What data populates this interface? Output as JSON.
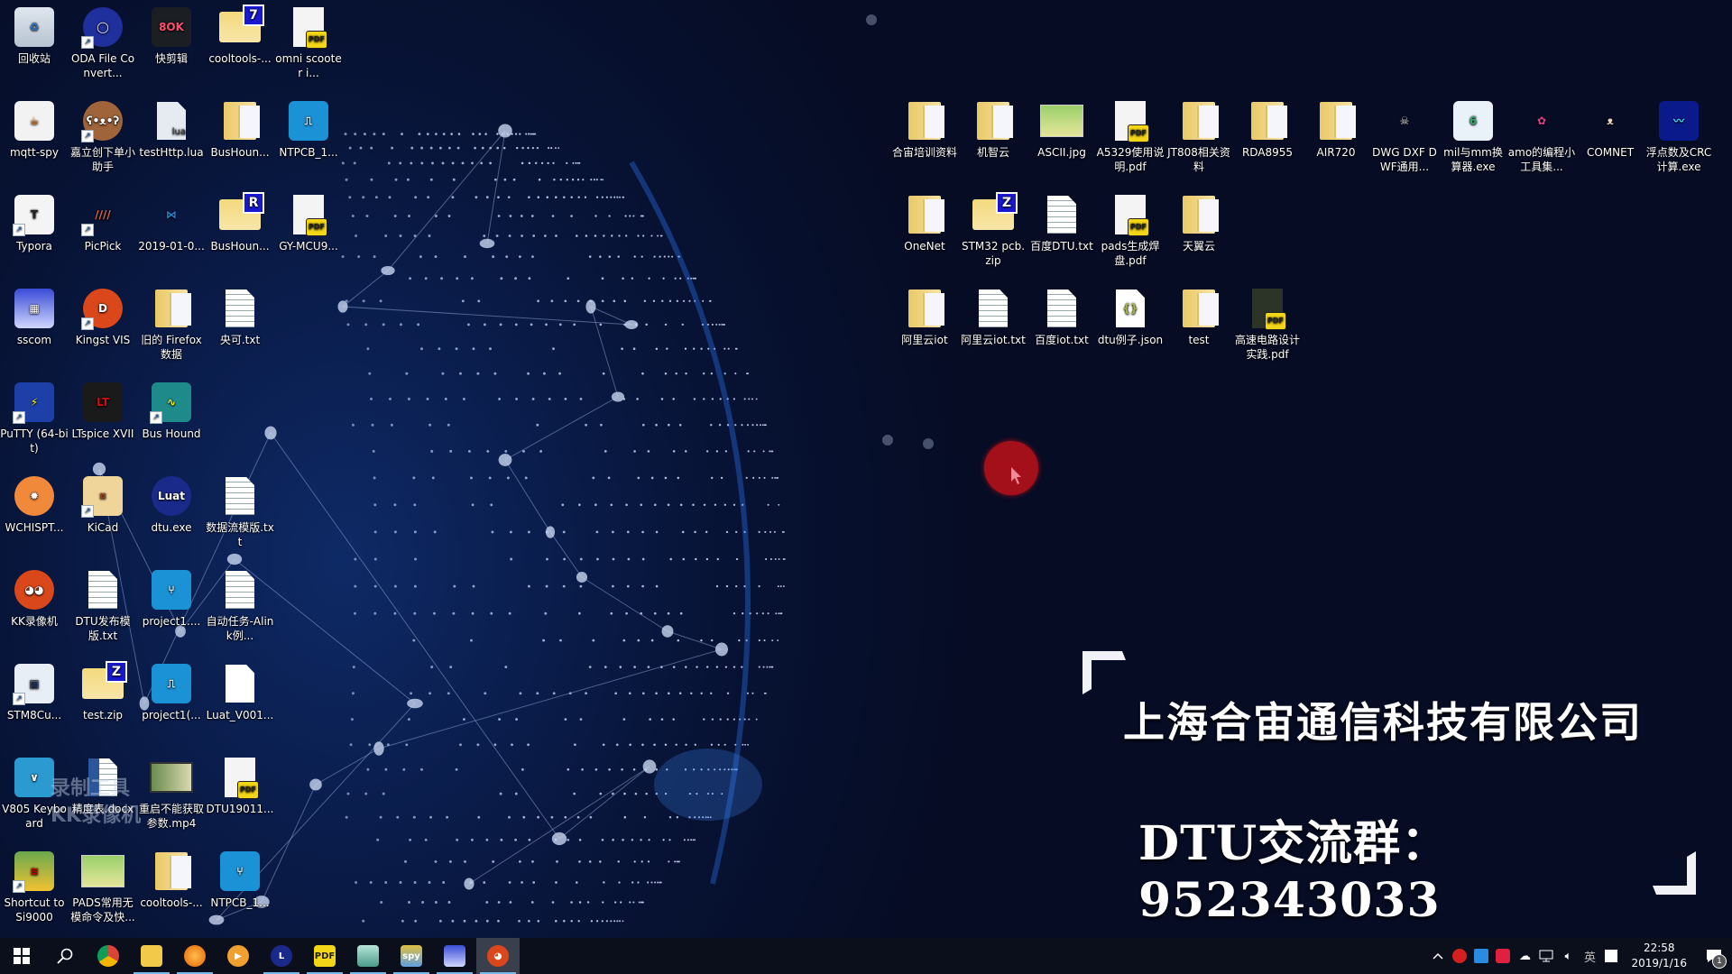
{
  "desktop": {
    "left_icons": [
      {
        "label": "回收站",
        "icon": "recycle-bin-icon",
        "shortcut": false
      },
      {
        "label": "ODA File Convert...",
        "icon": "oda-converter-icon",
        "shortcut": true
      },
      {
        "label": "快剪辑",
        "icon": "kuaijianji-icon",
        "shortcut": false
      },
      {
        "label": "cooltools-...",
        "icon": "zip-folder-icon",
        "shortcut": false,
        "badge": "7"
      },
      {
        "label": "omni scooter i...",
        "icon": "pdf-file-icon",
        "shortcut": false
      },
      {
        "label": "mqtt-spy",
        "icon": "java-icon",
        "shortcut": false
      },
      {
        "label": "嘉立创下单小助手",
        "icon": "bear-app-icon",
        "shortcut": true
      },
      {
        "label": "testHttp.lua",
        "icon": "lua-file-icon",
        "shortcut": false
      },
      {
        "label": "BusHoun...",
        "icon": "folder-icon",
        "shortcut": false
      },
      {
        "label": "NTPCB_1...",
        "icon": "ntpcb-project-icon",
        "shortcut": false
      },
      {
        "label": "Typora",
        "icon": "typora-icon",
        "shortcut": true
      },
      {
        "label": "PicPick",
        "icon": "picpick-icon",
        "shortcut": true
      },
      {
        "label": "2019-01-0...",
        "icon": "vscode-icon",
        "shortcut": false
      },
      {
        "label": "BusHoun...",
        "icon": "zip-folder-icon",
        "shortcut": false,
        "badge": "R"
      },
      {
        "label": "GY-MCU9...",
        "icon": "pdf-file-icon",
        "shortcut": false
      },
      {
        "label": "sscom",
        "icon": "sscom-icon",
        "shortcut": false
      },
      {
        "label": "Kingst VIS",
        "icon": "kingst-icon",
        "shortcut": true
      },
      {
        "label": "旧的 Firefox 数据",
        "icon": "folder-icon",
        "shortcut": false
      },
      {
        "label": "央可.txt",
        "icon": "text-file-icon",
        "shortcut": false
      },
      {
        "label": "PuTTY (64-bit)",
        "icon": "putty-icon",
        "shortcut": true
      },
      {
        "label": "LTspice XVII",
        "icon": "ltspice-icon",
        "shortcut": false
      },
      {
        "label": "Bus Hound",
        "icon": "bushound-icon",
        "shortcut": true
      },
      {
        "label": "WCHISPT...",
        "icon": "wchisp-icon",
        "shortcut": false
      },
      {
        "label": "KiCad",
        "icon": "kicad-icon",
        "shortcut": true
      },
      {
        "label": "dtu.exe",
        "icon": "luat-icon",
        "shortcut": false
      },
      {
        "label": "数据流模版.txt",
        "icon": "text-file-icon",
        "shortcut": false
      },
      {
        "label": "KK录像机",
        "icon": "kk-recorder-icon",
        "shortcut": false
      },
      {
        "label": "DTU发布模版.txt",
        "icon": "text-file-icon",
        "shortcut": false
      },
      {
        "label": "project1....",
        "icon": "ntpcb-icon",
        "shortcut": false
      },
      {
        "label": "自动任务-Alink例...",
        "icon": "text-file-icon",
        "shortcut": false
      },
      {
        "label": "STM8Cu...",
        "icon": "stm8cube-icon",
        "shortcut": true
      },
      {
        "label": "test.zip",
        "icon": "zip-folder-icon",
        "shortcut": false,
        "badge": "Z"
      },
      {
        "label": "project1(...",
        "icon": "ntpcb-project-icon",
        "shortcut": false
      },
      {
        "label": "Luat_V001...",
        "icon": "blank-file-icon",
        "shortcut": false
      },
      {
        "label": "V805 Keyboard",
        "icon": "v805-keyboard-icon",
        "shortcut": false
      },
      {
        "label": "精度表.docx",
        "icon": "word-doc-icon",
        "shortcut": false
      },
      {
        "label": "重启不能获取参数.mp4",
        "icon": "video-file-icon",
        "shortcut": false
      },
      {
        "label": "DTU19011...",
        "icon": "pdf-file-icon",
        "shortcut": false
      },
      {
        "label": "Shortcut to Si9000",
        "icon": "si9000-icon",
        "shortcut": true
      },
      {
        "label": "PADS常用无模命令及快...",
        "icon": "image-file-icon",
        "shortcut": false
      },
      {
        "label": "cooltools-...",
        "icon": "folder-icon",
        "shortcut": false
      },
      {
        "label": "NTPCB_1...",
        "icon": "ntpcb-icon",
        "shortcut": false
      }
    ],
    "right_icons": [
      {
        "label": "合宙培训资料",
        "icon": "folder-icon"
      },
      {
        "label": "机智云",
        "icon": "folder-icon"
      },
      {
        "label": "ASCII.jpg",
        "icon": "image-file-icon"
      },
      {
        "label": "A5329使用说明.pdf",
        "icon": "pdf-file-icon"
      },
      {
        "label": "JT808相关资料",
        "icon": "folder-icon"
      },
      {
        "label": "RDA8955",
        "icon": "folder-icon"
      },
      {
        "label": "AIR720",
        "icon": "folder-icon"
      },
      {
        "label": "DWG DXF DWF通用...",
        "icon": "skull-app-icon"
      },
      {
        "label": "mil与mm换算器.exe",
        "icon": "mil-mm-converter-icon"
      },
      {
        "label": "amo的编程小工具集...",
        "icon": "amo-tools-icon"
      },
      {
        "label": "COMNET",
        "icon": "comnet-icon"
      },
      {
        "label": "浮点数及CRC计算.exe",
        "icon": "crc-calc-icon"
      },
      {
        "label": "OneNet",
        "icon": "folder-icon"
      },
      {
        "label": "STM32 pcb.zip",
        "icon": "zip-folder-icon",
        "badge": "Z"
      },
      {
        "label": "百度DTU.txt",
        "icon": "text-file-icon"
      },
      {
        "label": "pads生成焊盘.pdf",
        "icon": "pdf-file-icon"
      },
      {
        "label": "天翼云",
        "icon": "folder-icon"
      },
      {
        "label": "阿里云iot",
        "icon": "folder-icon"
      },
      {
        "label": "阿里云iot.txt",
        "icon": "text-file-icon"
      },
      {
        "label": "百度iot.txt",
        "icon": "text-file-icon"
      },
      {
        "label": "dtu例子.json",
        "icon": "json-file-icon"
      },
      {
        "label": "test",
        "icon": "folder-icon"
      },
      {
        "label": "高速电路设计实践.pdf",
        "icon": "pdf-book-icon"
      }
    ]
  },
  "overlay": {
    "company": "上海合宙通信科技有限公司",
    "group": "DTU交流群：952343033"
  },
  "watermark": {
    "line1": "录制工具",
    "line2": "KK录像机"
  },
  "taskbar": {
    "start_label": "Start",
    "search_label": "Search",
    "pinned": [
      {
        "name": "chrome",
        "icon": "chrome-icon",
        "running": false
      },
      {
        "name": "file-explorer",
        "icon": "folder-icon",
        "running": true
      },
      {
        "name": "firefox",
        "icon": "firefox-icon",
        "running": true
      },
      {
        "name": "video-player",
        "icon": "player-icon",
        "running": false
      },
      {
        "name": "luat-dtu",
        "icon": "luat-icon",
        "running": true
      },
      {
        "name": "pdf-reader",
        "icon": "pdf-icon",
        "running": true
      },
      {
        "name": "notepad",
        "icon": "notepad-icon",
        "running": true
      },
      {
        "name": "mqtt-spy",
        "icon": "spy-icon",
        "running": true
      },
      {
        "name": "sscom",
        "icon": "sscom-icon",
        "running": true
      },
      {
        "name": "kk-recorder",
        "icon": "kk-recorder-icon",
        "running": true,
        "active": true
      }
    ],
    "tray": {
      "ime": "英",
      "time": "22:58",
      "date": "2019/1/16",
      "notifications": "1"
    }
  },
  "colors": {
    "wallpaper": "#070d26",
    "taskbar": "#0b0f1c",
    "cursor_highlight": "#a3101a",
    "running_indicator": "#76b9ed"
  }
}
